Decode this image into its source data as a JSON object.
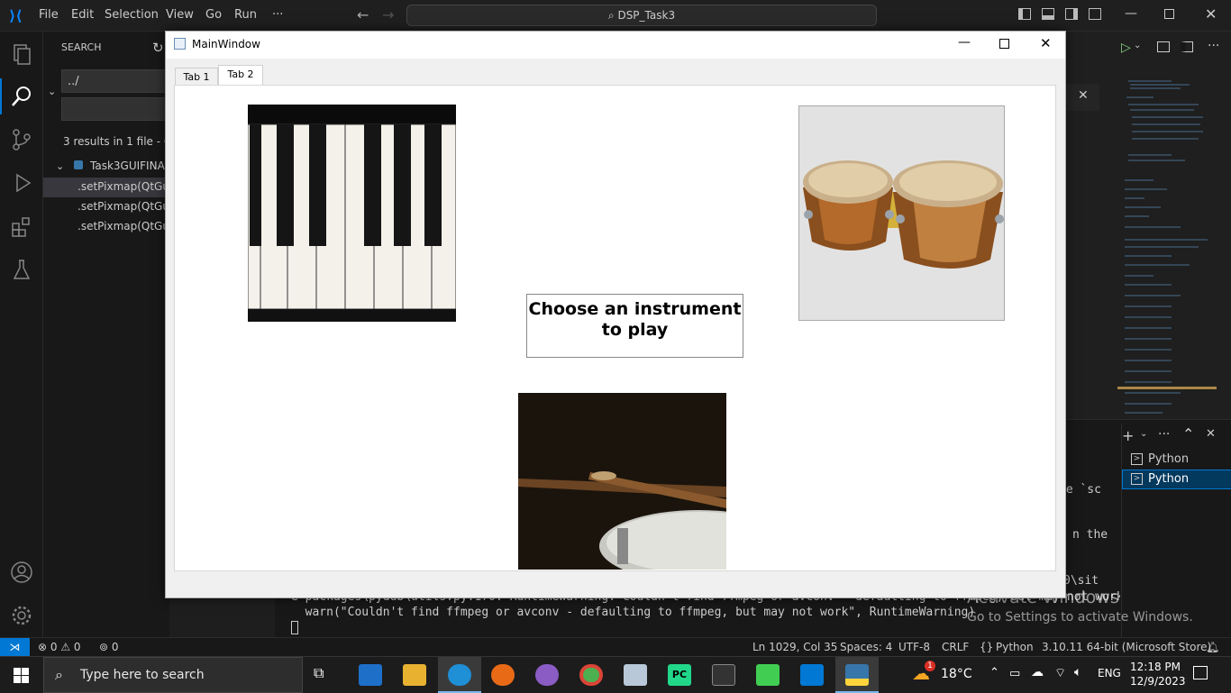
{
  "vscode": {
    "menu": [
      "File",
      "Edit",
      "Selection",
      "View",
      "Go",
      "Run",
      "···"
    ],
    "command_center": "DSP_Task3",
    "sidebar_title": "SEARCH",
    "search_value": "../",
    "results_summary": "3 results in 1 file - C",
    "result_file": "Task3GUIFINAL",
    "results": [
      ".setPixmap(QtGu",
      ".setPixmap(QtGu",
      ".setPixmap(QtGu"
    ],
    "terminal_tabs": [
      "Python",
      "Python"
    ],
    "terminal_lines": [
      "e packages\\pydub\\utils.py:170: RuntimeWarning: Couldn't find ffmpeg or avconv - defaulting to ffmpeg, but may not work",
      "  warn(\"Couldn't find ffmpeg or avconv - defaulting to ffmpeg, but may not work\", RuntimeWarning)"
    ],
    "terminal_fragments": [
      "he `sc",
      "n the",
      "0\\sit"
    ],
    "status": {
      "errors": "0",
      "warnings": "0",
      "ports": "0",
      "position": "Ln 1029, Col 35",
      "spaces": "Spaces: 4",
      "encoding": "UTF-8",
      "eol": "CRLF",
      "language": "Python",
      "interpreter": "3.10.11 64-bit (Microsoft Store)"
    },
    "activation": {
      "title": "Activate Windows",
      "subtitle": "Go to Settings to activate Windows."
    }
  },
  "qt": {
    "window_title": "MainWindow",
    "tabs": [
      "Tab 1",
      "Tab 2"
    ],
    "active_tab": "Tab 2",
    "prompt": "Choose an instrument to play",
    "instruments": [
      "piano-image",
      "bongo-drums-image",
      "snare-drum-image"
    ]
  },
  "taskbar": {
    "search_placeholder": "Type here to search",
    "temperature": "18°C",
    "language": "ENG",
    "time": "12:18 PM",
    "date": "12/9/2023",
    "notification_count": "1"
  },
  "colors": {
    "vscode_blue": "#0078d4",
    "editor_bg": "#1f1f1f",
    "qt_bg": "#f0f0f0"
  }
}
